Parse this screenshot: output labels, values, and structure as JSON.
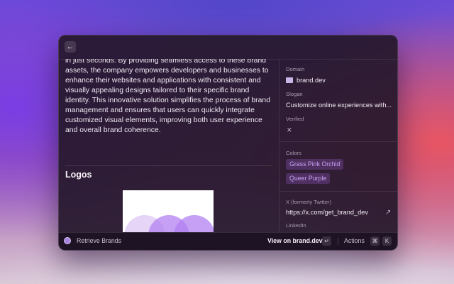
{
  "header": {
    "back_icon": "arrow-left-icon",
    "back_glyph": "←"
  },
  "description": "in just seconds. By providing seamless access to these brand assets, the company empowers developers and businesses to enhance their websites and applications with consistent and visually appealing designs tailored to their specific brand identity. This innovative solution simplifies the process of brand management and ensures that users can quickly integrate customized visual elements, improving both user experience and overall brand coherence.",
  "logos": {
    "heading": "Logos"
  },
  "metadata": {
    "domain_label": "Domain",
    "domain_value": "brand.dev",
    "slogan_label": "Slogan",
    "slogan_value": "Customize online experiences with...",
    "verified_label": "Verified",
    "verified_value": "✕",
    "colors_label": "Colors",
    "colors": [
      {
        "name": "Grass Pink Orchid",
        "hex": "#c7a2f4"
      },
      {
        "name": "Queer Purple",
        "hex": "#b57edc"
      }
    ],
    "twitter_label": "X (formerly Twitter)",
    "twitter_value": "https://x.com/get_brand_dev",
    "twitter_icon": "external-link-icon",
    "twitter_glyph": "↗",
    "linkedin_label": "LinkedIn"
  },
  "footer": {
    "extension_name": "Retrieve Brands",
    "primary_action": "View on brand.dev",
    "enter_key": "↵",
    "actions_label": "Actions",
    "cmd_key": "⌘",
    "k_key": "K"
  },
  "colors": {
    "accent": "#c7a2f4",
    "window_bg": "#26182c"
  }
}
